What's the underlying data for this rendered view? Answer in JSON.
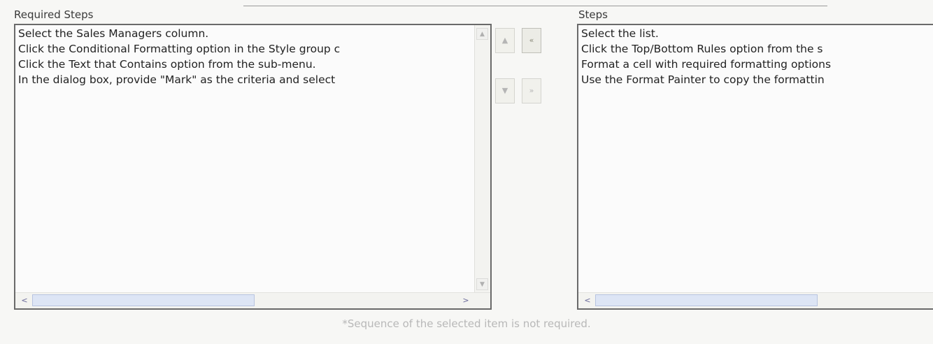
{
  "left_panel": {
    "label": "Required Steps",
    "items": [
      "Select the Sales Managers column.",
      "Click the Conditional Formatting option in the Style group c",
      "Click the Text that Contains option from the sub-menu.",
      "In the dialog box, provide \"Mark\" as the criteria and select"
    ]
  },
  "right_panel": {
    "label": "Steps",
    "items": [
      "Select the list.",
      "Click the Top/Bottom Rules option from the s",
      "Format a cell with required formatting options",
      "Use the Format Painter to copy the formattin"
    ]
  },
  "buttons": {
    "move_up": "▲",
    "move_to_left": "«",
    "move_down": "▼",
    "move_to_right": "»"
  },
  "scroll_glyphs": {
    "up": "▲",
    "down": "▼",
    "left": "<",
    "right": ">"
  },
  "footnote": "*Sequence of the selected item is not required."
}
